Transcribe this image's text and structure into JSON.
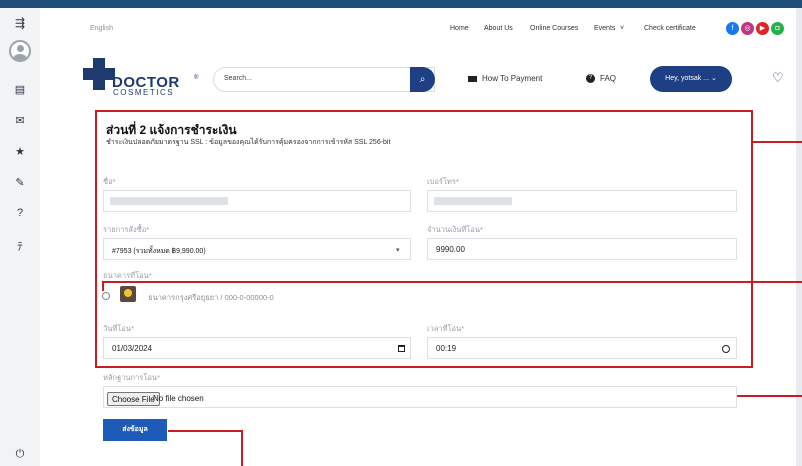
{
  "header": {
    "language": "English",
    "nav": [
      "Home",
      "About Us",
      "Online Courses",
      "Events",
      "Check certificate"
    ],
    "events_caret": "˅",
    "social_icons": [
      {
        "name": "facebook-icon",
        "glyph": "f",
        "color": "#1877f2"
      },
      {
        "name": "instagram-icon",
        "glyph": "◎",
        "color": "#c13584"
      },
      {
        "name": "youtube-icon",
        "glyph": "▶",
        "color": "#e02424"
      },
      {
        "name": "line-icon",
        "glyph": "◘",
        "color": "#22b14c"
      }
    ]
  },
  "logo": {
    "word": "DOCTOR",
    "reg": "®",
    "sub": "COSMETICS"
  },
  "search": {
    "placeholder": "Search...",
    "icon": "⌕"
  },
  "menu": {
    "how_to_payment": "How To Payment",
    "faq": "FAQ",
    "user": "Hey, yotsak ... ⌄",
    "heart": "♡"
  },
  "sidebar": {
    "menu_icon": "⇶",
    "icons": [
      "▤",
      "✉",
      "★",
      "✎",
      "?",
      "ﾃ"
    ],
    "power_icon": "⏻"
  },
  "form": {
    "title": "ส่วนที่ 2 แจ้งการชำระเงิน",
    "subtitle": "ชำระเงินปลอดภัยมาตรฐาน SSL : ข้อมูลของคุณได้รับการคุ้มครองจากการเข้ารหัส SSL 256-bit",
    "name_label": "ชื่อ*",
    "phone_label": "เบอร์โทร*",
    "order_label": "รายการสั่งซื้อ*",
    "order_value": "#7953 (รวมทั้งหมด ฿9,990.00)",
    "amount_label": "จำนวนเงินที่โอน*",
    "amount_value": "9990.00",
    "bank_label": "ธนาคารที่โอน*",
    "bank_option": "ธนาคารกรุงศรีอยุธยา / 000-0-00000-0",
    "date_label": "วันที่โอน*",
    "date_value": "01/03/2024",
    "time_label": "เวลาที่โอน*",
    "time_value": "00:19",
    "proof_label": "หลักฐานการโอน*",
    "choose_file": "Choose File",
    "no_file": "No file chosen",
    "submit": "ส่งข้อมูล"
  },
  "colors": {
    "accent": "#1e3f84",
    "annotation": "#c91d25",
    "submit": "#1e5bb8"
  }
}
